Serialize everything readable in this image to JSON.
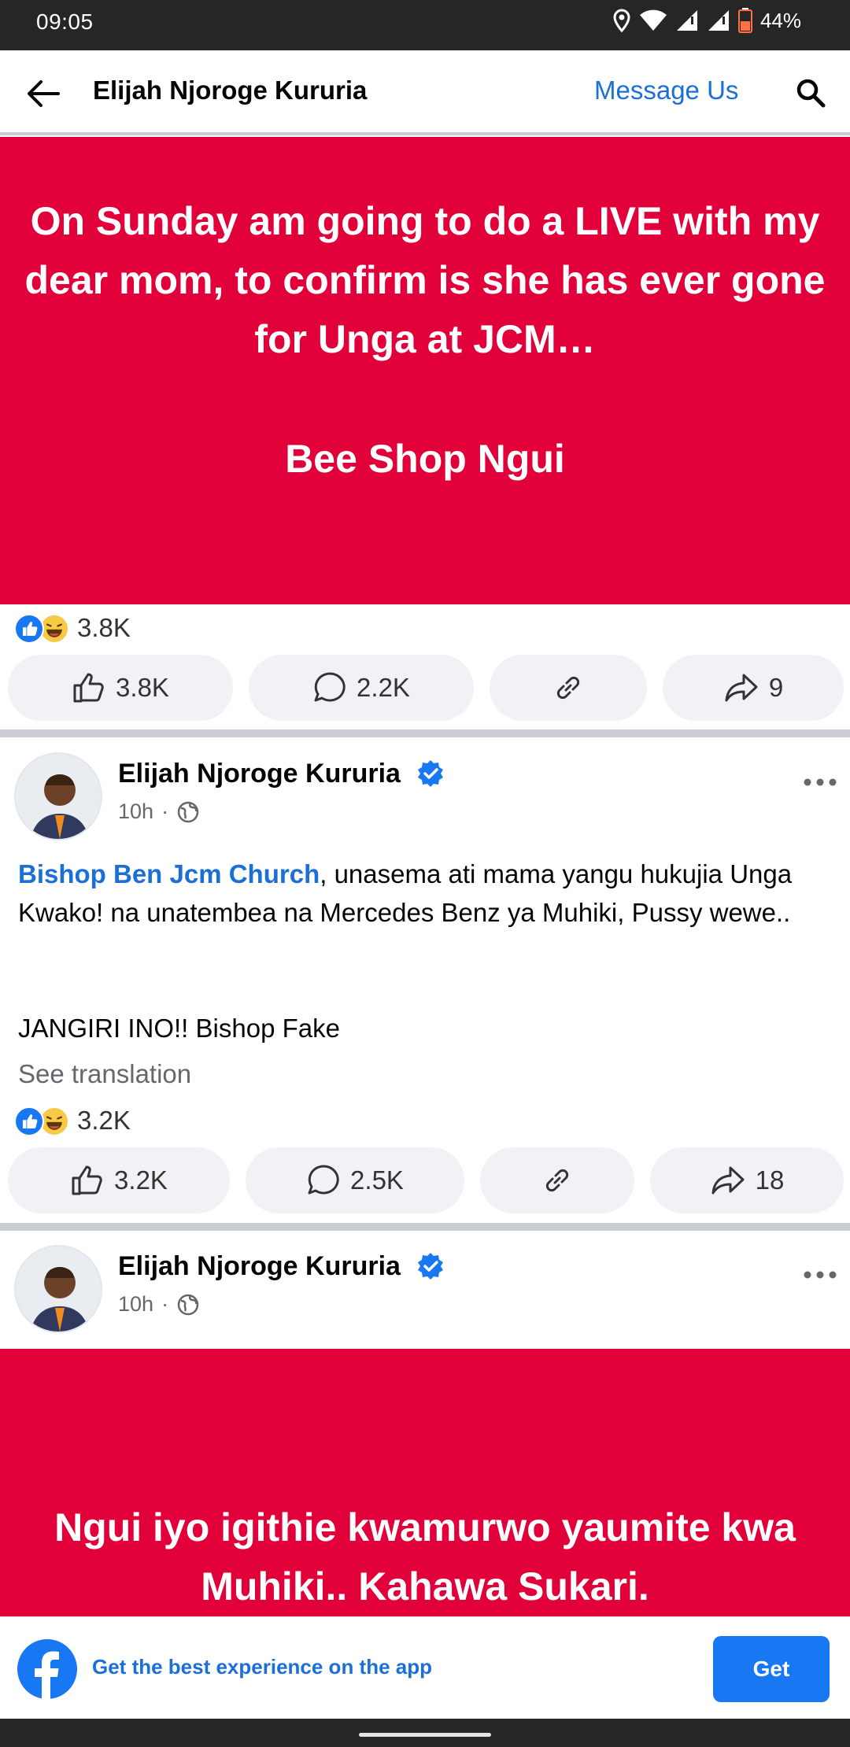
{
  "status_bar": {
    "time": "09:05",
    "battery": "44%",
    "icons": [
      "location-icon",
      "wifi-icon",
      "signal-icon",
      "signal-icon",
      "battery-icon"
    ]
  },
  "header": {
    "title": "Elijah Njoroge Kururia",
    "message_us": "Message Us"
  },
  "post1": {
    "text": "On Sunday am going to do a LIVE with my dear mom, to confirm is she has ever gone for Unga at JCM…",
    "subtext": "Bee Shop Ngui",
    "background": "#e10039",
    "reaction_count": "3.8K",
    "like_count": "3.8K",
    "comment_count": "2.2K",
    "share_count": "9"
  },
  "post2": {
    "author": "Elijah Njoroge Kururia",
    "time": "10h",
    "mention": "Bishop Ben Jcm Church",
    "body_rest": ", unasema ati mama yangu hukujia Unga Kwako!  na unatembea na Mercedes Benz ya Muhiki, Pussy wewe..",
    "body_line2": "JANGIRI INO!! Bishop Fake",
    "see_translation": "See translation",
    "reaction_count": "3.2K",
    "like_count": "3.2K",
    "comment_count": "2.5K",
    "share_count": "18"
  },
  "post3": {
    "author": "Elijah Njoroge Kururia",
    "time": "10h",
    "text": "Ngui iyo igithie kwamurwo yaumite kwa Muhiki.. Kahawa Sukari.",
    "background": "#e10039"
  },
  "banner": {
    "text": "Get the best experience on the app",
    "button": "Get"
  },
  "colors": {
    "accent": "#1877f2",
    "link": "#1b6fd6",
    "post_red": "#e10039"
  }
}
